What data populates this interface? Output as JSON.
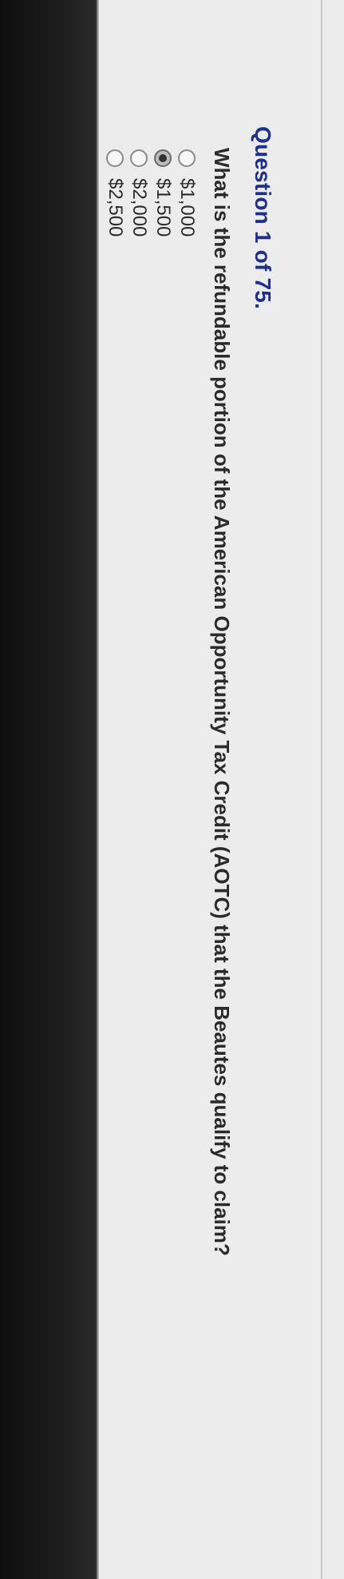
{
  "question": {
    "title": "Question 1 of 75.",
    "text": "What is the refundable portion of the American Opportunity Tax Credit (AOTC) that the Beautes qualify to claim?",
    "options": [
      {
        "label": "$1,000",
        "selected": false
      },
      {
        "label": "$1,500",
        "selected": true
      },
      {
        "label": "$2,000",
        "selected": false
      },
      {
        "label": "$2,500",
        "selected": false
      }
    ]
  },
  "colors": {
    "title": "#1f2f8a",
    "text": "#2b2b2b",
    "page_background": "#ececec"
  }
}
